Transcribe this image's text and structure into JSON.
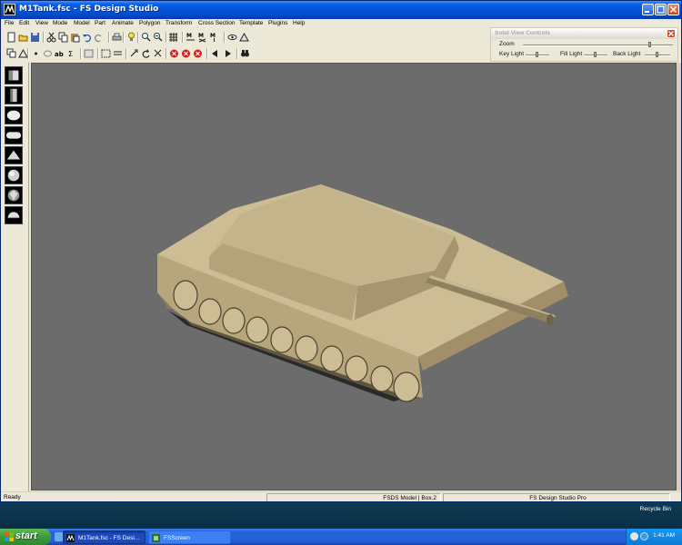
{
  "window": {
    "title": "M1Tank.fsc - FS Design Studio"
  },
  "menu": [
    "File",
    "Edit",
    "View",
    "Mode",
    "Model",
    "Part",
    "Animate",
    "Polygon",
    "Transform",
    "Cross Section",
    "Template",
    "Plugins",
    "Help"
  ],
  "toolbar1_icons": [
    "new-icon",
    "open-icon",
    "save-icon",
    "cut-icon",
    "copy-icon",
    "paste-icon",
    "undo-icon",
    "redo-icon",
    "print-icon",
    "hint-icon",
    "zoom-in-icon",
    "zoom-out-icon",
    "grid-icon",
    "mirror-x-icon",
    "mirror-y-icon",
    "mirror-z-icon",
    "eye-icon",
    "render-icon"
  ],
  "toolbar2_icons": [
    "copy-view-icon",
    "triangle-icon",
    "point-icon",
    "ellipse-icon",
    "text-icon",
    "sum-icon",
    "texture-icon",
    "select-icon",
    "line-icon",
    "rotate-icon",
    "refresh-icon",
    "scale-icon",
    "stop-red-icon",
    "stop-red-icon",
    "stop-red-icon",
    "play-back-icon",
    "play-forward-icon",
    "binoculars-icon"
  ],
  "palette": [
    "cube-icon",
    "cylinder-icon",
    "sphere-icon",
    "capsule-icon",
    "wedge-icon",
    "geosphere-icon",
    "gem-icon",
    "hemisphere-icon"
  ],
  "solid_view_controls": {
    "title": "Solid View Controls",
    "zoom_label": "Zoom",
    "key_light_label": "Key Light",
    "fill_light_label": "Fill Light",
    "back_light_label": "Back Light",
    "zoom_level": 0.85,
    "key_light_level": 0.5,
    "fill_light_level": 0.5,
    "back_light_level": 0.5
  },
  "status": {
    "ready": "Ready",
    "model": "FSDS Model | Box.2",
    "product": "FS Design Studio Pro"
  },
  "desktop": {
    "recycle_bin": "Recycle Bin"
  },
  "taskbar": {
    "start": "start",
    "task1": "M1Tank.fsc - FS Desi...",
    "task2": "FSScreen",
    "clock": "1:41 AM"
  },
  "colors": {
    "title_blue": "#0052d6",
    "viewport_gray": "#6c6c6c",
    "tank_tan": "#cdbd94",
    "taskbar_blue": "#245edb",
    "start_green": "#3c9a3b"
  }
}
